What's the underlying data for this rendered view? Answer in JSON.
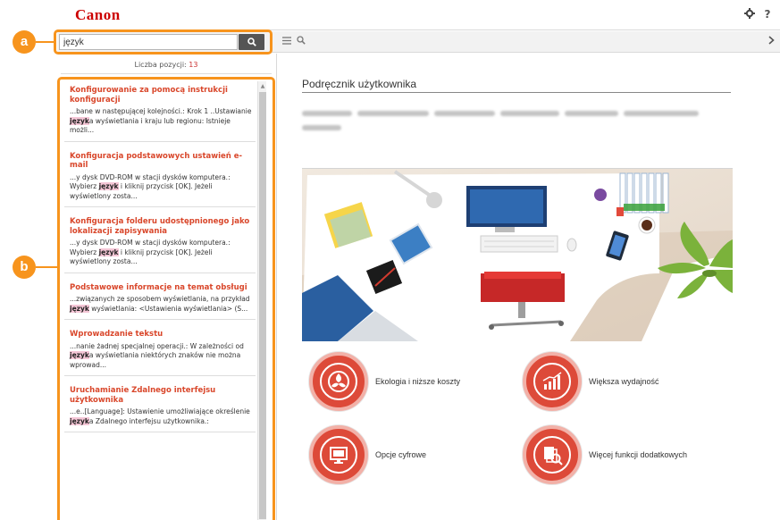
{
  "header": {
    "logo": "Canon",
    "settings_icon": "gear-icon",
    "help_label": "?"
  },
  "search": {
    "value": "język",
    "button_icon": "search-icon"
  },
  "toolbar": {
    "list_icon": "list-icon",
    "search_icon": "search-icon",
    "next_icon": "chevron-right-icon"
  },
  "callouts": {
    "a": "a",
    "b": "b"
  },
  "results_count": {
    "label": "Liczba pozycji:",
    "value": "13"
  },
  "results": [
    {
      "title": "Konfigurowanie za pomocą instrukcji konfiguracji",
      "snippet": [
        {
          "t": "...bane w następującej kolejności.: Krok 1 ..Ustawianie ",
          "k": false
        },
        {
          "t": "język",
          "k": true
        },
        {
          "t": "a wyświetlania i kraju lub regionu: Istnieje możli...",
          "k": false
        }
      ]
    },
    {
      "title": "Konfiguracja podstawowych ustawień e-mail",
      "snippet": [
        {
          "t": "...y dysk DVD-ROM w stacji dysków komputera.: Wybierz ",
          "k": false
        },
        {
          "t": "język",
          "k": true
        },
        {
          "t": " i kliknij przycisk [OK]. Jeżeli wyświetlony zosta...",
          "k": false
        }
      ]
    },
    {
      "title": "Konfiguracja folderu udostępnionego jako lokalizacji zapisywania",
      "snippet": [
        {
          "t": "...y dysk DVD-ROM w stacji dysków komputera.: Wybierz ",
          "k": false
        },
        {
          "t": "język",
          "k": true
        },
        {
          "t": " i kliknij przycisk [OK]. Jeżeli wyświetlony zosta...",
          "k": false
        }
      ]
    },
    {
      "title": "Podstawowe informacje na temat obsługi",
      "snippet": [
        {
          "t": "...związanych ze sposobem wyświetlania, na przykład ",
          "k": false
        },
        {
          "t": "język",
          "k": true
        },
        {
          "t": " wyświetlania: <Ustawienia wyświetlania> (S...",
          "k": false
        }
      ]
    },
    {
      "title": "Wprowadzanie tekstu",
      "snippet": [
        {
          "t": "...nanie żadnej specjalnej operacji.: W zależności od ",
          "k": false
        },
        {
          "t": "język",
          "k": true
        },
        {
          "t": "a wyświetlania niektórych znaków nie można wprowad...",
          "k": false
        }
      ]
    },
    {
      "title": "Uruchamianie Zdalnego interfejsu użytkownika",
      "snippet": [
        {
          "t": "...e..[Language]: Ustawienie umożliwiające określenie ",
          "k": false
        },
        {
          "t": "język",
          "k": true
        },
        {
          "t": "a Zdalnego interfejsu użytkownika.:",
          "k": false
        }
      ]
    }
  ],
  "main": {
    "title": "Podręcznik użytkownika",
    "tiles": [
      {
        "label": "Ekologia i niższe koszty",
        "icon": "leaf-icon"
      },
      {
        "label": "Większa wydajność",
        "icon": "chart-icon"
      },
      {
        "label": "Opcje cyfrowe",
        "icon": "monitor-icon"
      },
      {
        "label": "Więcej funkcji dodatkowych",
        "icon": "documents-magnifier-icon"
      }
    ]
  },
  "colors": {
    "accent": "#f7941d",
    "brand": "#cc0000",
    "link": "#d9472b",
    "tile": "#dd4a39",
    "highlight": "#f5c6d6"
  }
}
